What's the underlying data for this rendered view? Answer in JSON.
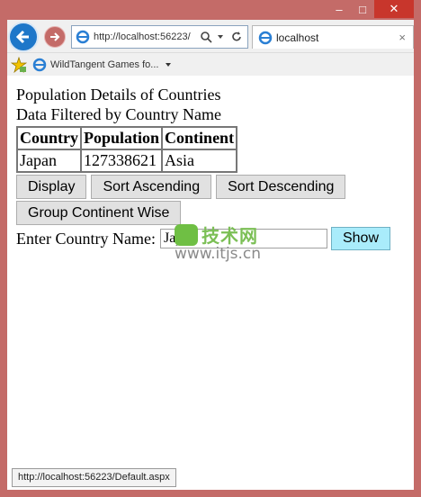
{
  "browser": {
    "address": "http://localhost:56223/",
    "tab_title": "localhost",
    "tab_close": "×",
    "favorites_item": "WildTangent Games fo...",
    "status_url": "http://localhost:56223/Default.aspx",
    "window_controls": {
      "minimize": "–",
      "maximize": "□",
      "close": "✕"
    }
  },
  "page": {
    "heading1": "Population Details of Countries",
    "heading2": "Data Filtered by Country Name",
    "table": {
      "headers": [
        "Country",
        "Population",
        "Continent"
      ],
      "rows": [
        [
          "Japan",
          "127338621",
          "Asia"
        ]
      ]
    },
    "buttons": {
      "display": "Display",
      "sort_asc": "Sort Ascending",
      "sort_desc": "Sort Descending",
      "group": "Group Continent Wise"
    },
    "country_label": "Enter Country Name:",
    "country_value": "Japan",
    "show_button": "Show"
  },
  "watermark": {
    "line1": "技术网",
    "line2": "www.itjs.cn"
  }
}
